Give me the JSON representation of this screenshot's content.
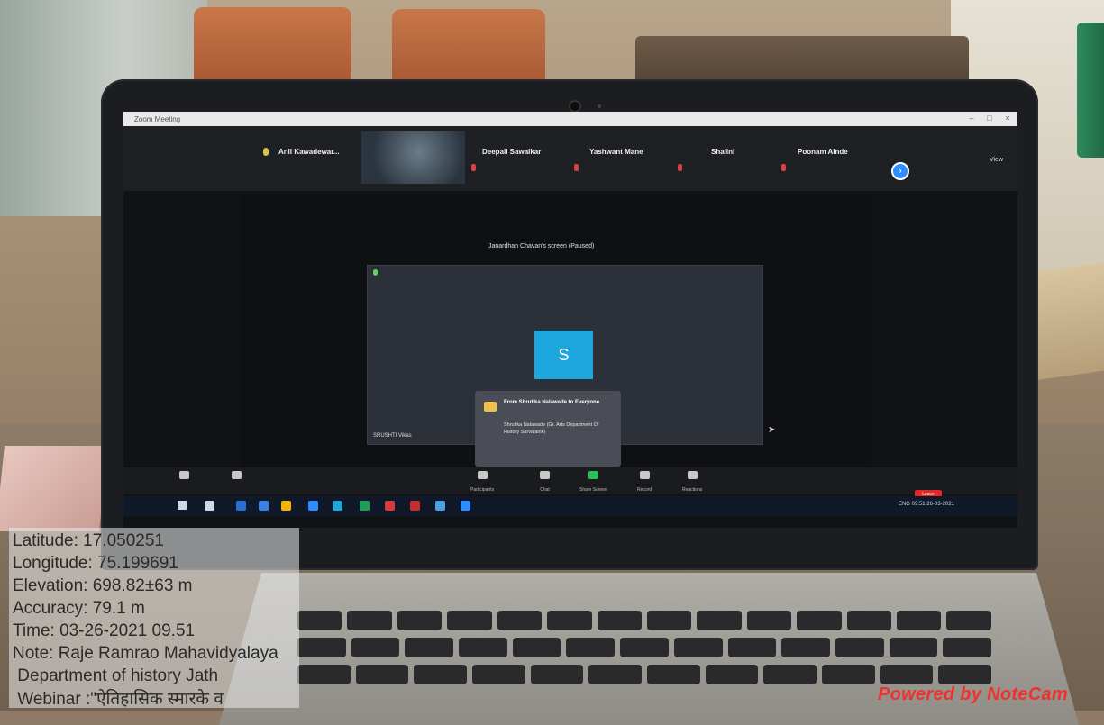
{
  "photo": {
    "zoom_window": {
      "title": "Zoom Meeting",
      "participants": [
        {
          "name": "Anil Kawadewar..."
        },
        {
          "name": "Deepali Sawalkar"
        },
        {
          "name": "Yashwant Mane"
        },
        {
          "name": "Shalini"
        },
        {
          "name": "Poonam Alnde"
        }
      ],
      "view_label": "View",
      "share_banner": "Janardhan Chavan's screen (Paused)",
      "tile_avatar_letter": "S",
      "tile_name": "SRUSHTI Vikas",
      "chat_popup": {
        "from": "From Shrutika Nalawade to Everyone",
        "message": "Shrutika Nalawade (Gr. Arts Department Of History Sarvajanik)"
      },
      "toolbar": [
        {
          "label": "Participants"
        },
        {
          "label": "Chat"
        },
        {
          "label": "Share Screen"
        },
        {
          "label": "Record"
        },
        {
          "label": "Reactions"
        }
      ],
      "end_label": "Leave",
      "tray_text": "ENG  09:51  26-03-2021"
    }
  },
  "gps_overlay": {
    "latitude": "Latitude: 17.050251",
    "longitude": "Longitude: 75.199691",
    "elevation": "Elevation: 698.82±63 m",
    "accuracy": "Accuracy: 79.1 m",
    "time": "Time: 03-26-2021 09.51",
    "note": "Note: Raje Ramrao Mahavidyalaya",
    "department": " Department of history Jath",
    "webinar": " Webinar :\"ऐतिहासिक स्मारके व"
  },
  "watermark": "Powered by NoteCam"
}
